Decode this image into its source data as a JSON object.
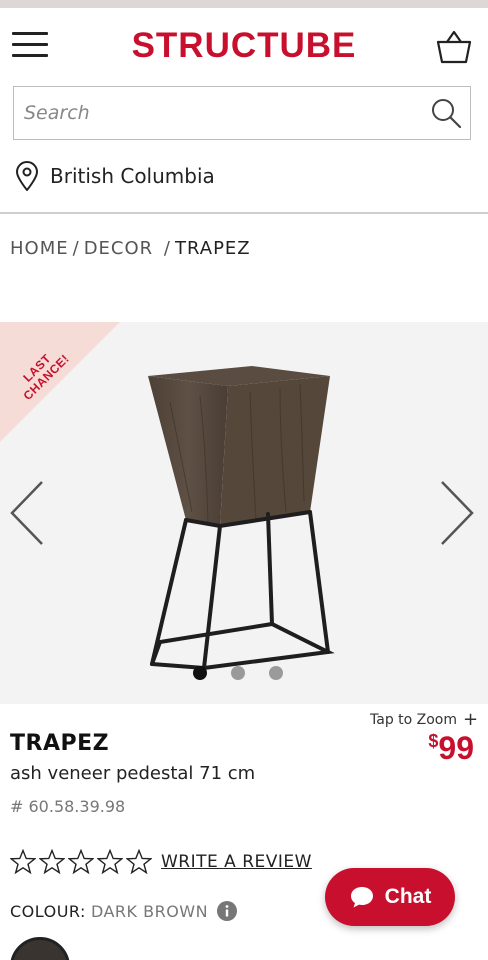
{
  "brand": {
    "logo_text": "STRUCTUBE",
    "accent": "#c8102e"
  },
  "header": {
    "menu_icon": "hamburger-menu-icon",
    "cart_icon": "shopping-basket-icon"
  },
  "search": {
    "placeholder": "Search",
    "value": "",
    "icon": "search-icon"
  },
  "location": {
    "icon": "map-pin-icon",
    "label": "British Columbia"
  },
  "breadcrumb": {
    "items": [
      "HOME",
      "DECOR",
      "TRAPEZ"
    ],
    "separator": "/"
  },
  "gallery": {
    "badge": "LAST CHANCE!",
    "badge_color": "#f5dcd6",
    "slide_count": 3,
    "active_slide": 0,
    "prev_icon": "chevron-left-icon",
    "next_icon": "chevron-right-icon",
    "image_icon": "side-table-image"
  },
  "product": {
    "zoom_label": "Tap to Zoom",
    "zoom_icon": "plus-icon",
    "name": "TRAPEZ",
    "price_currency": "$",
    "price_amount": "99",
    "description": "ash veneer pedestal 71 cm",
    "sku": "# 60.58.39.98"
  },
  "rating": {
    "stars_filled": 0,
    "stars_total": 5,
    "star_icon": "star-outline-icon",
    "review_link": "WRITE A REVIEW"
  },
  "colour": {
    "label": "COLOUR:",
    "value": "DARK BROWN",
    "info_icon": "info-icon",
    "swatch_color": "#3a3430"
  },
  "chat": {
    "label": "Chat",
    "icon": "chat-bubble-icon"
  }
}
